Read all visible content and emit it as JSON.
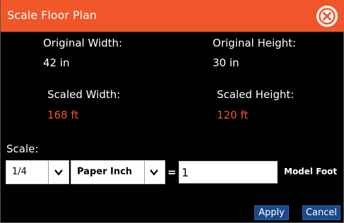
{
  "dialog": {
    "title": "Scale Floor Plan",
    "close_icon": "close-circle-icon",
    "accent_color": "#f0562a"
  },
  "original": {
    "width_label": "Original Width:",
    "width_value": "42 in",
    "height_label": "Original Height:",
    "height_value": "30 in"
  },
  "scaled": {
    "width_label": "Scaled Width:",
    "width_value": "168 ft",
    "height_label": "Scaled Height:",
    "height_value": "120 ft"
  },
  "scale": {
    "label": "Scale:",
    "ratio_selected": "1/4",
    "unit_selected": "Paper Inch",
    "equals": "=",
    "input_value": "1",
    "model_unit": "Model Foot"
  },
  "actions": {
    "apply_label": "Apply",
    "cancel_label": "Cancel"
  }
}
